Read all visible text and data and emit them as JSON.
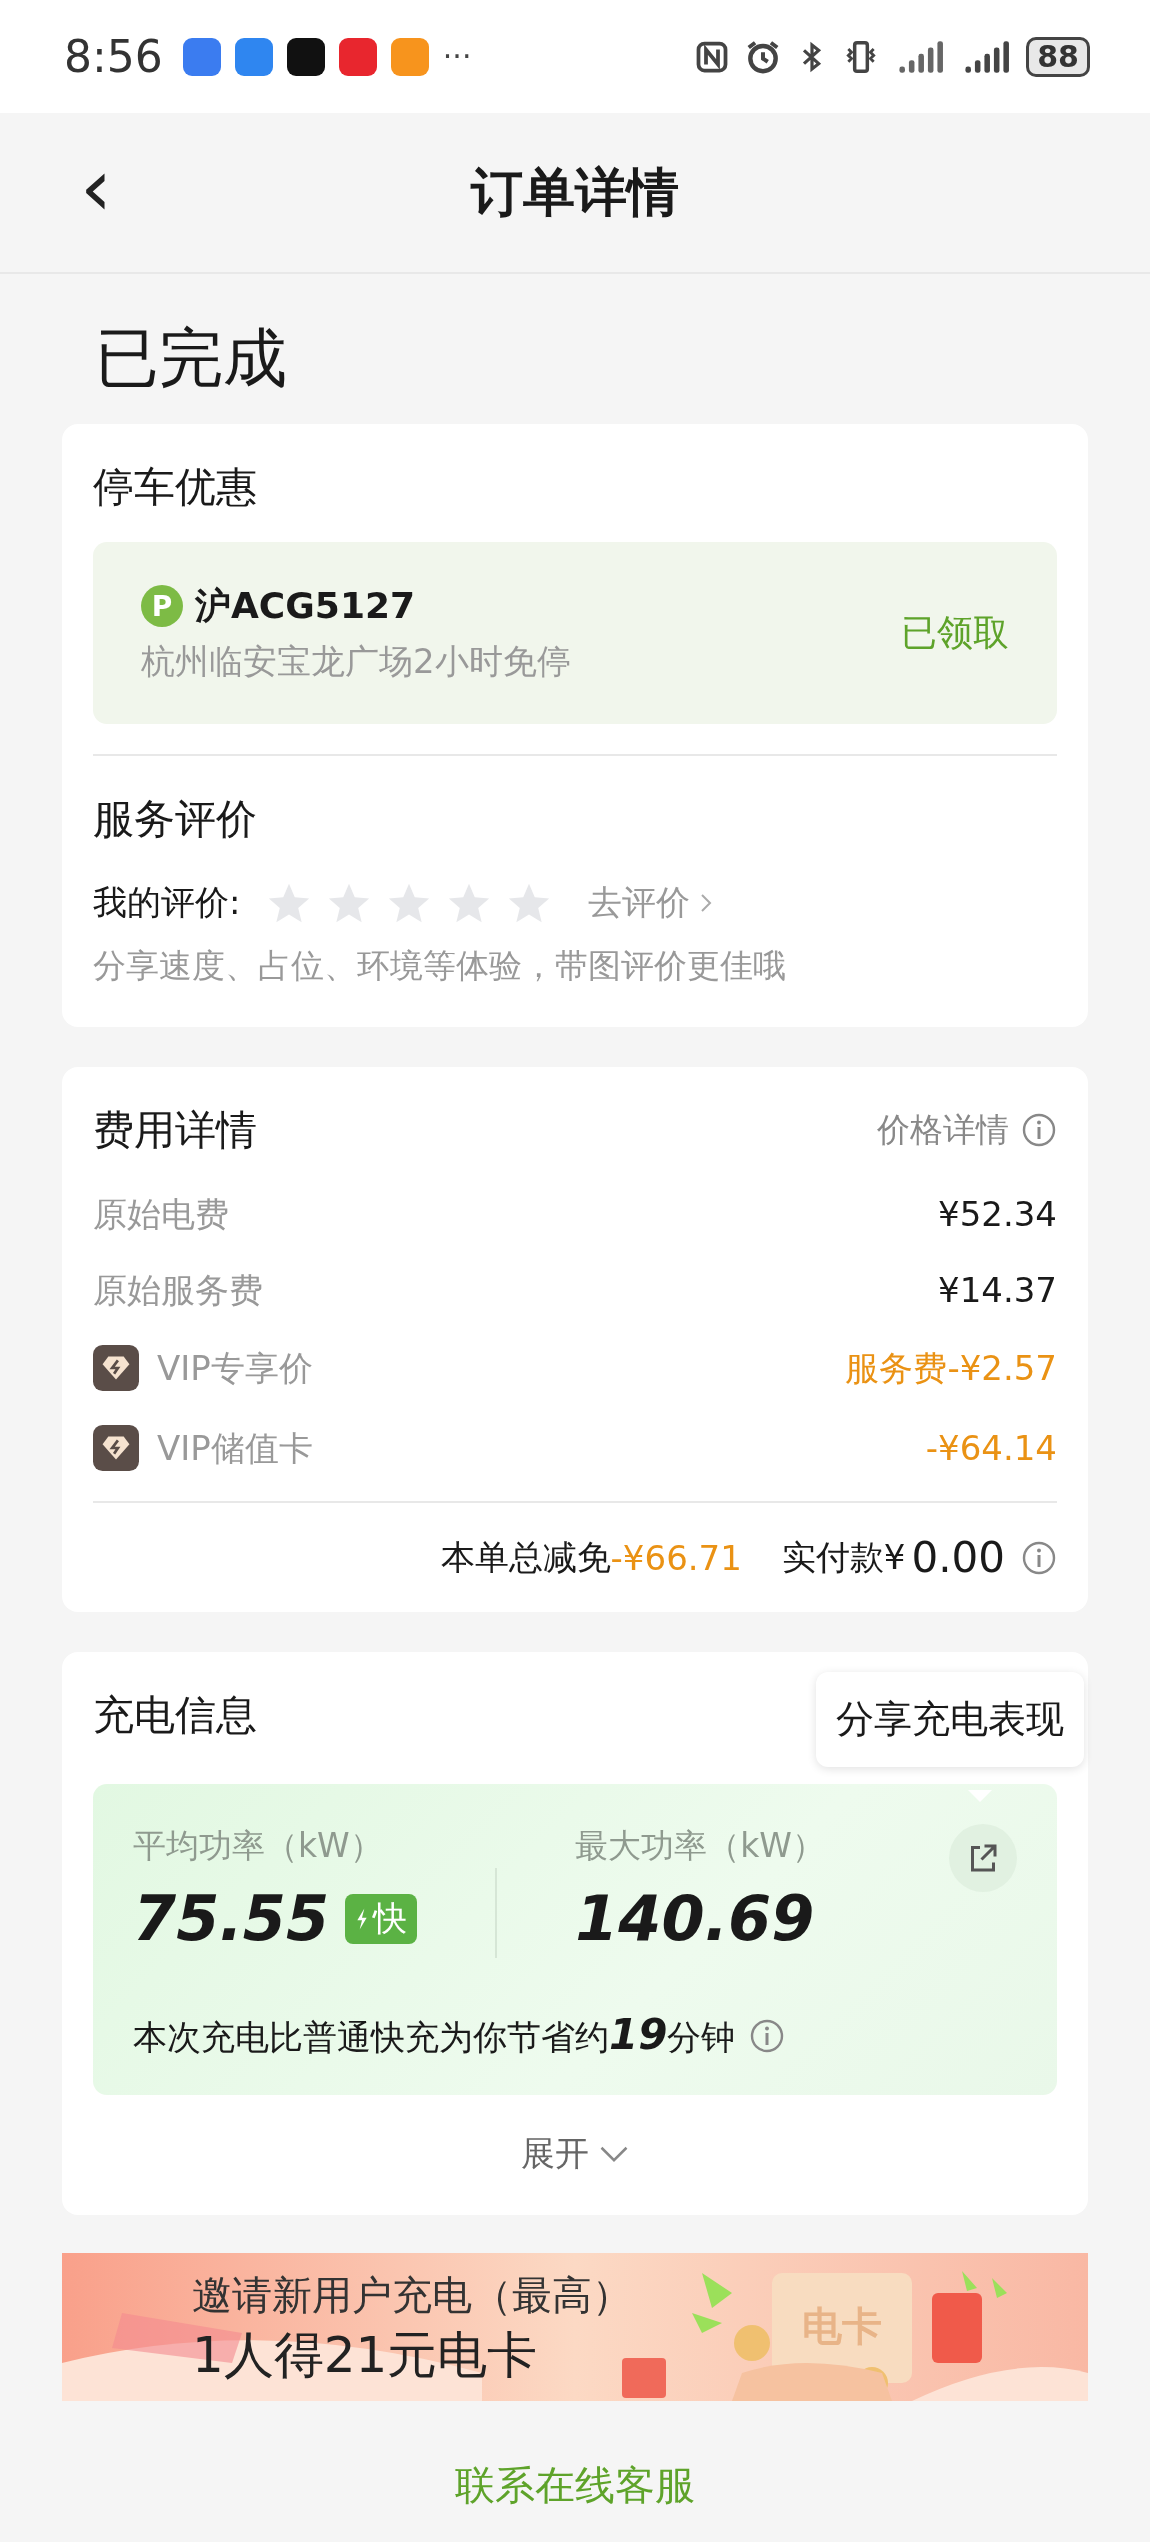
{
  "status_bar": {
    "time": "8:56",
    "more": "···",
    "battery": "88"
  },
  "nav": {
    "back": "‹",
    "title": "订单详情"
  },
  "order_status": "已完成",
  "parking": {
    "title": "停车优惠",
    "badge": "P",
    "plate": "沪ACG5127",
    "desc": "杭州临安宝龙广场2小时免停",
    "state": "已领取"
  },
  "review": {
    "title": "服务评价",
    "label": "我的评价:",
    "stars": 0,
    "action": "去评价",
    "hint": "分享速度、占位、环境等体验，带图评价更佳哦"
  },
  "fees": {
    "title": "费用详情",
    "detail_link": "价格详情",
    "rows": [
      {
        "kind": "plain",
        "label": "原始电费",
        "value": "¥52.34"
      },
      {
        "kind": "plain",
        "label": "原始服务费",
        "value": "¥14.37"
      },
      {
        "kind": "vip",
        "label": "VIP专享价",
        "value": "服务费-¥2.57"
      },
      {
        "kind": "vip",
        "label": "VIP储值卡",
        "value": "-¥64.14"
      }
    ],
    "discount_label": "本单总减免",
    "discount_value": "-¥66.71",
    "paid_label": "实付款¥",
    "paid_value": "0.00"
  },
  "charging": {
    "title": "充电信息",
    "tooltip": "分享充电表现",
    "avg_label": "平均功率（kW）",
    "avg_value": "75.55",
    "fast_badge": "快",
    "max_label": "最大功率（kW）",
    "max_value": "140.69",
    "saving": "本次充电比普通快充为你节省约**19**分钟",
    "expand": "展开"
  },
  "banner": {
    "line1": "邀请新用户充电（最高）",
    "line2": "1人得21元电卡",
    "card_text": "电卡"
  },
  "contact": "联系在线客服"
}
